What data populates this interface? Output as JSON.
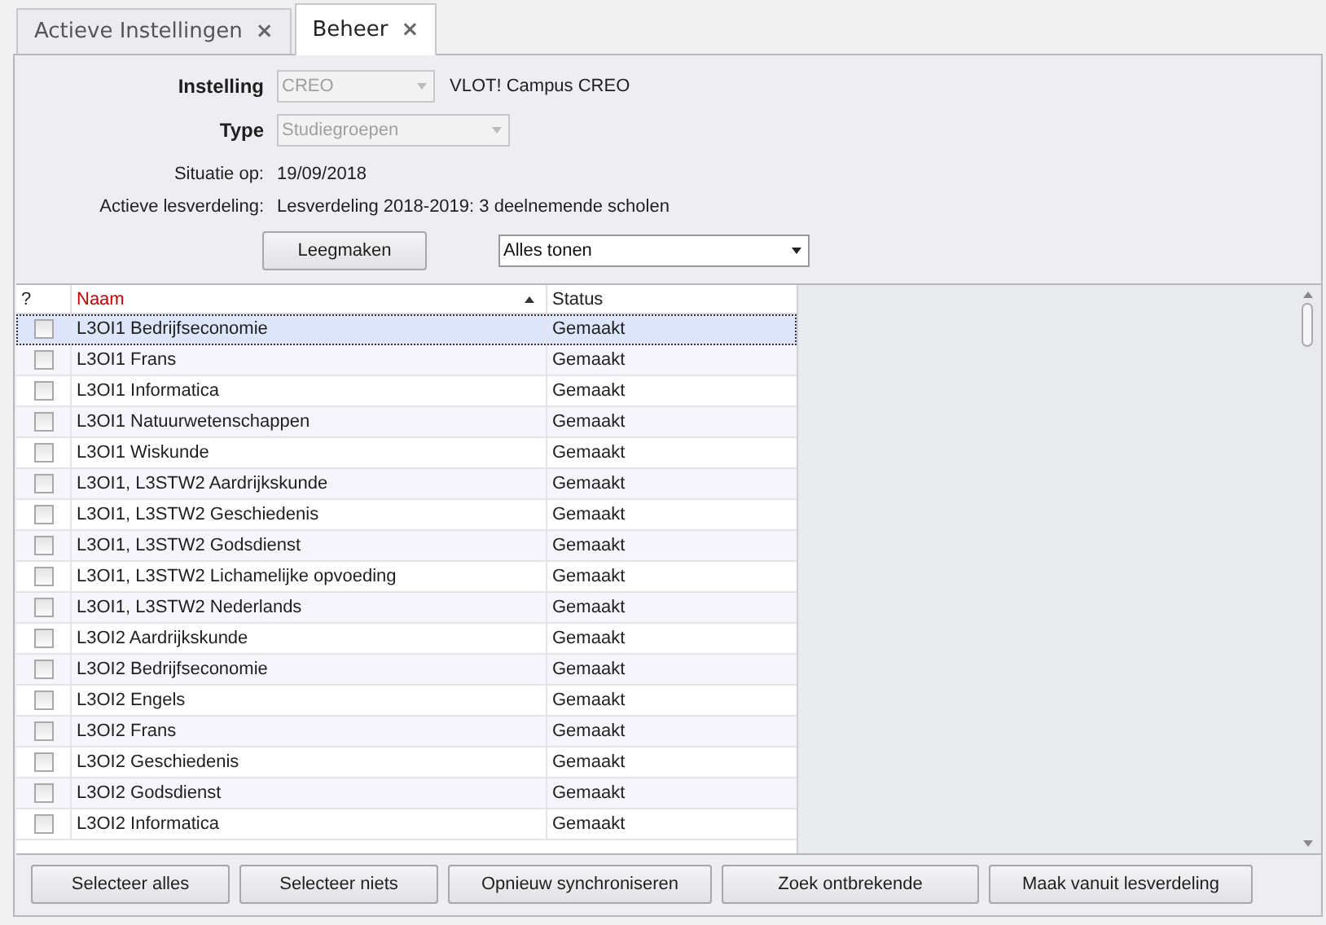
{
  "tabs": [
    {
      "label": "Actieve Instellingen",
      "selected": false,
      "close": "×"
    },
    {
      "label": "Beheer",
      "selected": true,
      "close": "×"
    }
  ],
  "form": {
    "instelling": {
      "label": "Instelling",
      "value": "CREO",
      "description": "VLOT! Campus CREO",
      "disabled": true
    },
    "type": {
      "label": "Type",
      "value": "Studiegroepen",
      "disabled": true
    },
    "situatie": {
      "label": "Situatie op:",
      "value": "19/09/2018"
    },
    "lesverdeling": {
      "label": "Actieve lesverdeling:",
      "value": "Lesverdeling 2018-2019: 3 deelnemende scholen"
    },
    "clear_button": "Leegmaken",
    "filter": {
      "value": "Alles tonen"
    }
  },
  "table": {
    "columns": [
      {
        "label": "?",
        "sorted": false
      },
      {
        "label": "Naam",
        "sorted": true
      },
      {
        "label": "Status",
        "sorted": false
      }
    ],
    "rows": [
      {
        "name": "L3OI1 Bedrijfseconomie",
        "status": "Gemaakt",
        "checked": false,
        "selected": true
      },
      {
        "name": "L3OI1 Frans",
        "status": "Gemaakt",
        "checked": false,
        "selected": false
      },
      {
        "name": "L3OI1 Informatica",
        "status": "Gemaakt",
        "checked": false,
        "selected": false
      },
      {
        "name": "L3OI1 Natuurwetenschappen",
        "status": "Gemaakt",
        "checked": false,
        "selected": false
      },
      {
        "name": "L3OI1 Wiskunde",
        "status": "Gemaakt",
        "checked": false,
        "selected": false
      },
      {
        "name": "L3OI1, L3STW2 Aardrijkskunde",
        "status": "Gemaakt",
        "checked": false,
        "selected": false
      },
      {
        "name": "L3OI1, L3STW2 Geschiedenis",
        "status": "Gemaakt",
        "checked": false,
        "selected": false
      },
      {
        "name": "L3OI1, L3STW2 Godsdienst",
        "status": "Gemaakt",
        "checked": false,
        "selected": false
      },
      {
        "name": "L3OI1, L3STW2 Lichamelijke opvoeding",
        "status": "Gemaakt",
        "checked": false,
        "selected": false
      },
      {
        "name": "L3OI1, L3STW2 Nederlands",
        "status": "Gemaakt",
        "checked": false,
        "selected": false
      },
      {
        "name": "L3OI2 Aardrijkskunde",
        "status": "Gemaakt",
        "checked": false,
        "selected": false
      },
      {
        "name": "L3OI2 Bedrijfseconomie",
        "status": "Gemaakt",
        "checked": false,
        "selected": false
      },
      {
        "name": "L3OI2 Engels",
        "status": "Gemaakt",
        "checked": false,
        "selected": false
      },
      {
        "name": "L3OI2 Frans",
        "status": "Gemaakt",
        "checked": false,
        "selected": false
      },
      {
        "name": "L3OI2 Geschiedenis",
        "status": "Gemaakt",
        "checked": false,
        "selected": false
      },
      {
        "name": "L3OI2 Godsdienst",
        "status": "Gemaakt",
        "checked": false,
        "selected": false
      },
      {
        "name": "L3OI2 Informatica",
        "status": "Gemaakt",
        "checked": false,
        "selected": false
      }
    ]
  },
  "buttons": [
    "Selecteer alles",
    "Selecteer niets",
    "Opnieuw synchroniseren",
    "Zoek ontbrekende",
    "Maak vanuit lesverdeling"
  ]
}
